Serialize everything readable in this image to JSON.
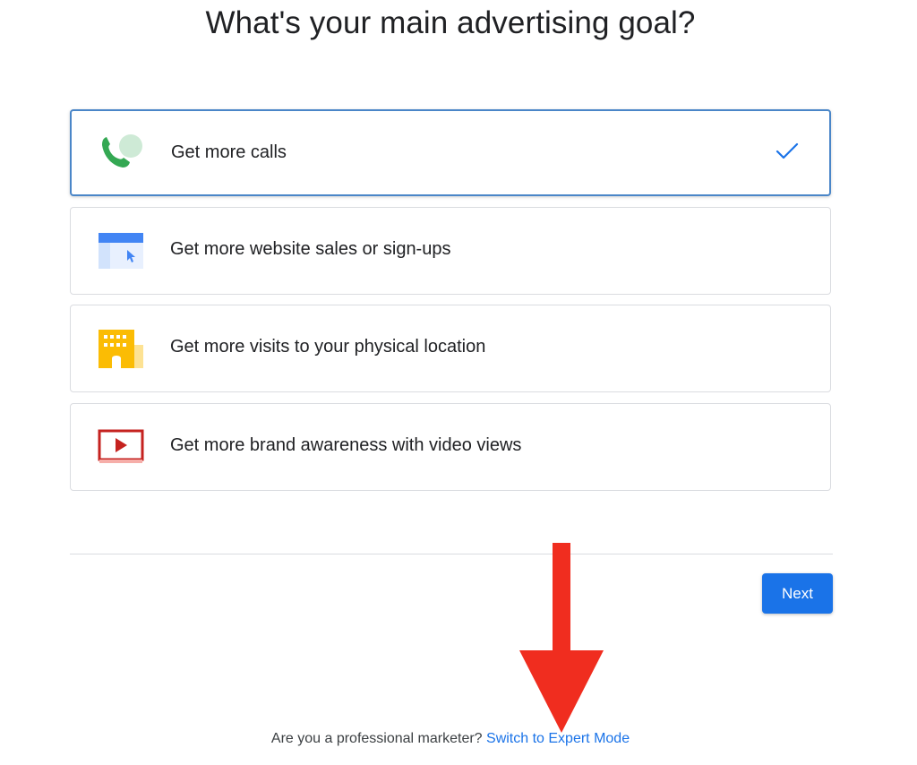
{
  "page": {
    "title": "What's your main advertising goal?"
  },
  "goals": [
    {
      "label": "Get more calls",
      "icon": "phone-icon",
      "selected": true
    },
    {
      "label": "Get more website sales or sign-ups",
      "icon": "website-icon",
      "selected": false
    },
    {
      "label": "Get more visits to your physical location",
      "icon": "storefront-icon",
      "selected": false
    },
    {
      "label": "Get more brand awareness with video views",
      "icon": "video-play-icon",
      "selected": false
    }
  ],
  "actions": {
    "next_label": "Next"
  },
  "footer": {
    "question": "Are you a professional marketer?",
    "link_label": "Switch to Expert Mode"
  },
  "colors": {
    "primary": "#1a73e8",
    "selected_border": "#4a86c8",
    "arrow": "#f02d1f",
    "phone_green": "#34a853",
    "video_red": "#c5221f",
    "building_yellow": "#fbbc04"
  }
}
